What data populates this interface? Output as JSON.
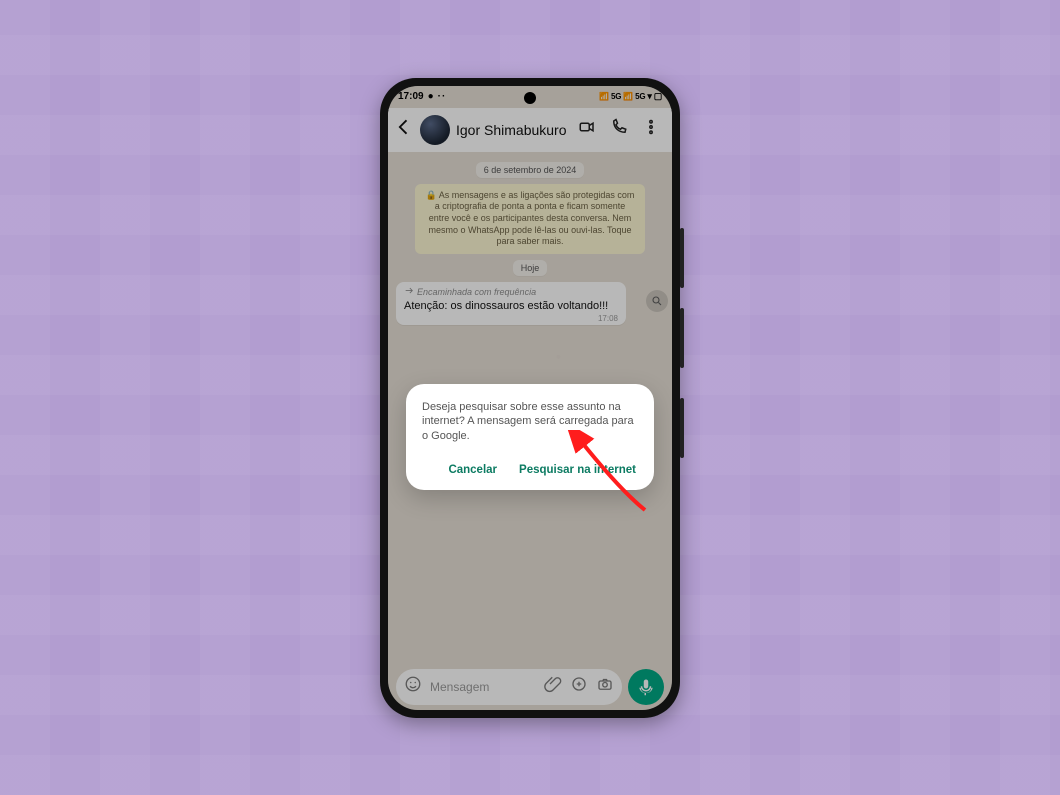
{
  "statusbar": {
    "time": "17:09",
    "network_label_1": "5G",
    "network_label_2": "5G"
  },
  "header": {
    "contact_name": "Igor Shimabukuro"
  },
  "chat": {
    "date_pill": "6 de setembro de 2024",
    "encryption_notice": "🔒 As mensagens e as ligações são protegidas com a criptografia de ponta a ponta e ficam somente entre você e os participantes desta conversa. Nem mesmo o WhatsApp pode lê-las ou ouvi-las. Toque para saber mais.",
    "today_pill": "Hoje",
    "forwarded_label": "Encaminhada com frequência",
    "message_text": "Atenção: os dinossauros estão voltando!!!",
    "message_time": "17:08"
  },
  "dialog": {
    "body": "Deseja pesquisar sobre esse assunto na internet? A mensagem será carregada para o Google.",
    "cancel": "Cancelar",
    "confirm": "Pesquisar na internet"
  },
  "input": {
    "placeholder": "Mensagem"
  },
  "icons": {
    "back": "back-arrow-icon",
    "video": "video-call-icon",
    "call": "phone-call-icon",
    "more": "more-vertical-icon",
    "search": "magnifier-icon",
    "emoji": "emoji-icon",
    "attach": "attachment-icon",
    "payment": "payment-icon",
    "camera": "camera-icon",
    "mic": "microphone-icon",
    "forward": "forward-icon"
  },
  "colors": {
    "background": "#b29dd0",
    "whatsapp_green": "#00a884",
    "dialog_action": "#0c7b62",
    "annotation_red": "#ff1d1d"
  }
}
